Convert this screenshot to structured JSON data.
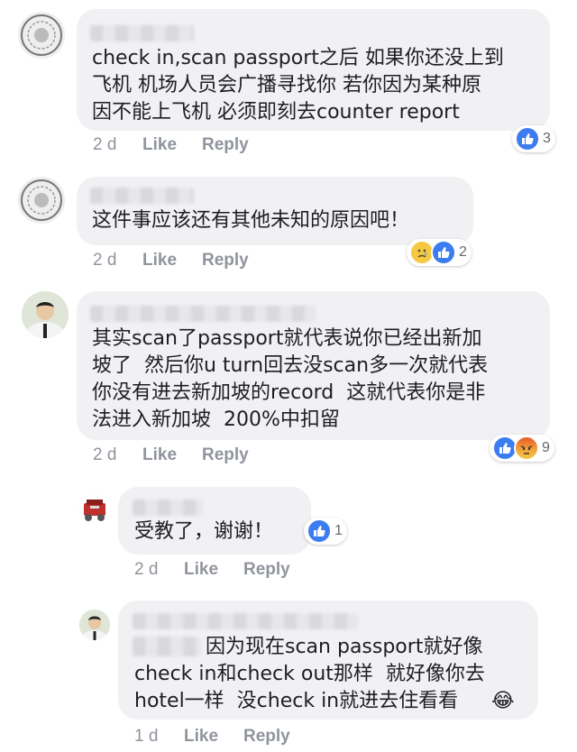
{
  "comments": [
    {
      "text_lines": [
        "check in,scan passport之后 如果你还没上到",
        "飞机 机场人员会广播寻找你 若你因为某种原",
        "因不能上飞机 必须即刻去counter report"
      ],
      "age": "2 d",
      "like": "Like",
      "reply": "Reply",
      "reaction_count": "3",
      "reactions": [
        "like-icon"
      ]
    },
    {
      "text_lines": [
        "这件事应该还有其他未知的原因吧！"
      ],
      "age": "2 d",
      "like": "Like",
      "reply": "Reply",
      "reaction_count": "2",
      "reactions": [
        "sad-icon",
        "like-icon"
      ]
    },
    {
      "text_lines": [
        "其实scan了passport就代表说你已经出新加",
        "坡了  然后你u turn回去没scan多一次就代表",
        "你没有进去新加坡的record  这就代表你是非",
        "法进入新加坡  200%中扣留"
      ],
      "age": "2 d",
      "like": "Like",
      "reply": "Reply",
      "reaction_count": "9",
      "reactions": [
        "like-icon",
        "angry-icon"
      ]
    },
    {
      "text_lines": [
        "受教了，谢谢！"
      ],
      "age": "2 d",
      "like": "Like",
      "reply": "Reply",
      "reaction_count": "1",
      "reactions": [
        "like-icon"
      ]
    },
    {
      "text_lines": [
        "因为现在scan passport就好像",
        "check in和check out那样  就好像你去",
        "hotel一样  没check in就进去住看看"
      ],
      "age": "1 d",
      "like": "Like",
      "reply": "Reply",
      "reaction_count": "",
      "reactions": [],
      "trailing_emoji": "😂"
    }
  ],
  "colors": {
    "bubble": "#f1f1f3",
    "meta": "#90949c",
    "like_blue": "#3b7cf0",
    "text": "#1c1e21"
  }
}
